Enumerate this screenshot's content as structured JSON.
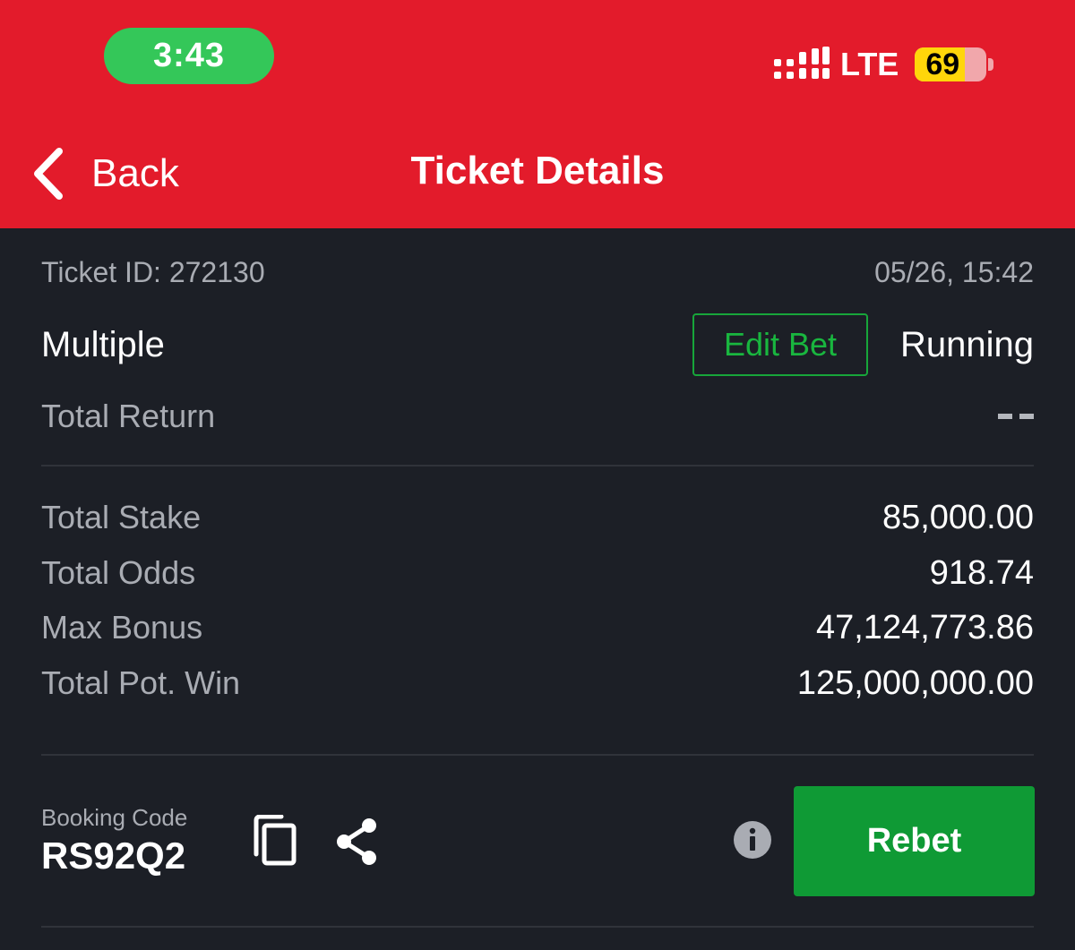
{
  "status_bar": {
    "time": "3:43",
    "network": "LTE",
    "battery": "69",
    "battery_level": 0.69
  },
  "nav": {
    "back_label": "Back",
    "title": "Ticket Details"
  },
  "ticket": {
    "id_label": "Ticket ID: 272130",
    "datetime": "05/26, 15:42",
    "bet_type": "Multiple",
    "edit_label": "Edit Bet",
    "status": "Running",
    "total_return_label": "Total Return"
  },
  "stats": [
    {
      "label": "Total Stake",
      "value": "85,000.00"
    },
    {
      "label": "Total Odds",
      "value": "918.74"
    },
    {
      "label": "Max Bonus",
      "value": "47,124,773.86"
    },
    {
      "label": "Total Pot. Win",
      "value": "125,000,000.00"
    }
  ],
  "booking": {
    "label": "Booking Code",
    "code": "RS92Q2"
  },
  "actions": {
    "rebet_label": "Rebet"
  },
  "icons": {
    "back": "chevron-left-icon",
    "signal": "signal-icon",
    "copy": "copy-icon",
    "share": "share-icon",
    "info": "info-icon"
  },
  "colors": {
    "header": "#e31b2b",
    "background": "#1c1f26",
    "accent_green": "#0f9a35",
    "time_pill": "#34c759",
    "battery": "#ffd60a"
  }
}
